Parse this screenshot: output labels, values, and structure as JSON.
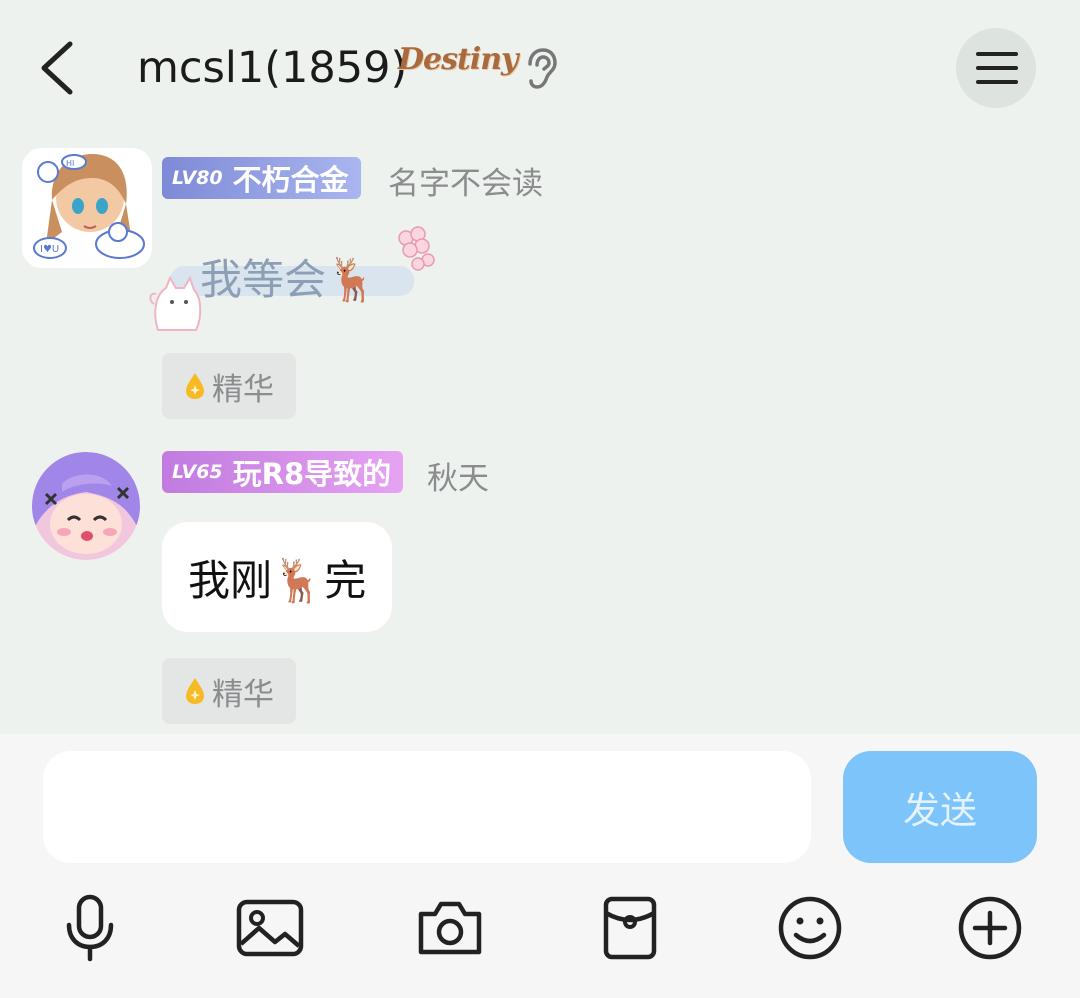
{
  "header": {
    "title": "mcsl1(1859)",
    "title_badge": "Destiny",
    "back_icon": "chevron-left-icon",
    "listen_icon": "ear-icon",
    "menu_icon": "hamburger-menu-icon"
  },
  "messages": [
    {
      "level": "LV80",
      "level_title": "不朽合金",
      "level_color": "#8b96de",
      "nickname": "名字不会读",
      "content_type": "sticker",
      "sticker_text": "我等会🦌",
      "essence_label": "精华"
    },
    {
      "level": "LV65",
      "level_title": "玩R8导致的",
      "level_color": "#d08de9",
      "nickname": "秋天",
      "content_type": "text",
      "text": "我刚🦌完",
      "essence_label": "精华"
    }
  ],
  "composer": {
    "input_value": "",
    "send_label": "发送",
    "send_color": "#7cc4fa"
  },
  "toolbar": {
    "icons": [
      "microphone-icon",
      "image-icon",
      "camera-icon",
      "red-packet-icon",
      "emoji-icon",
      "plus-circle-icon"
    ]
  }
}
